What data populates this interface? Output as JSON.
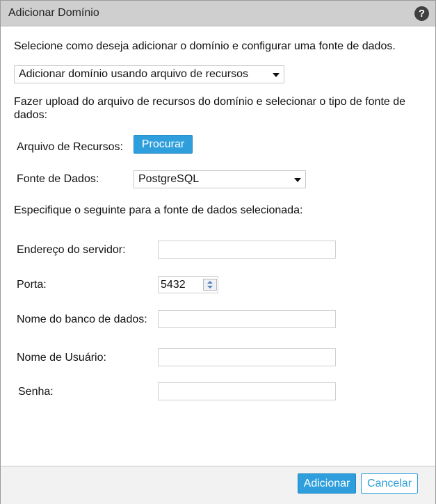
{
  "dialog": {
    "title": "Adicionar Domínio",
    "help_icon": "help-circle-icon"
  },
  "intro": "Selecione como deseja adicionar o domínio e configurar uma fonte de dados.",
  "method_select": {
    "value": "Adicionar domínio usando arquivo de recursos"
  },
  "upload_instructions": "Fazer upload do arquivo de recursos do domínio e selecionar o tipo de fonte de dados:",
  "resource_file": {
    "label": "Arquivo de Recursos:",
    "browse_label": "Procurar"
  },
  "datasource": {
    "label": "Fonte de Dados:",
    "value": "PostgreSQL"
  },
  "specify_text": "Especifique o seguinte para a fonte de dados selecionada:",
  "fields": {
    "server": {
      "label": "Endereço do servidor:",
      "value": ""
    },
    "port": {
      "label": "Porta:",
      "value": "5432"
    },
    "database": {
      "label": "Nome do banco de dados:",
      "value": ""
    },
    "username": {
      "label": "Nome de Usuário:",
      "value": ""
    },
    "password": {
      "label": "Senha:",
      "value": ""
    }
  },
  "footer": {
    "add_label": "Adicionar",
    "cancel_label": "Cancelar"
  },
  "colors": {
    "accent": "#2e9fdc",
    "titlebar": "#cfcfcf"
  }
}
